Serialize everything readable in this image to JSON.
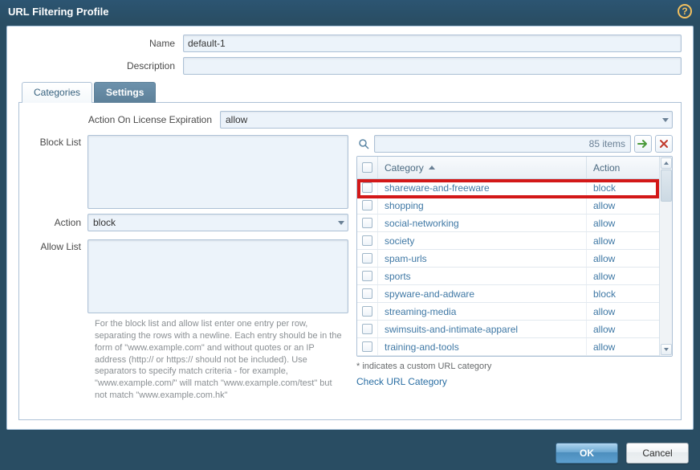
{
  "window": {
    "title": "URL Filtering Profile"
  },
  "form": {
    "name_label": "Name",
    "name_value": "default-1",
    "description_label": "Description",
    "description_value": ""
  },
  "tabs": {
    "categories": "Categories",
    "settings": "Settings",
    "active": "settings"
  },
  "settings": {
    "license_label": "Action On License Expiration",
    "license_value": "allow",
    "block_list_label": "Block List",
    "block_list_value": "",
    "action_label": "Action",
    "action_value": "block",
    "allow_list_label": "Allow List",
    "allow_list_value": "",
    "help_text": "For the block list and allow list enter one entry per row, separating the rows with a newline. Each entry should be in the form of \"www.example.com\" and without quotes or an IP address (http:// or https:// should not be included). Use separators to specify match criteria - for example, \"www.example.com/\" will match \"www.example.com/test\" but not match \"www.example.com.hk\""
  },
  "category_table": {
    "search_placeholder": "85 items",
    "header_category": "Category",
    "header_action": "Action",
    "rows": [
      {
        "name": "shareware-and-freeware",
        "action": "block"
      },
      {
        "name": "shopping",
        "action": "allow"
      },
      {
        "name": "social-networking",
        "action": "allow"
      },
      {
        "name": "society",
        "action": "allow"
      },
      {
        "name": "spam-urls",
        "action": "allow"
      },
      {
        "name": "sports",
        "action": "allow"
      },
      {
        "name": "spyware-and-adware",
        "action": "block"
      },
      {
        "name": "streaming-media",
        "action": "allow"
      },
      {
        "name": "swimsuits-and-intimate-apparel",
        "action": "allow"
      },
      {
        "name": "training-and-tools",
        "action": "allow"
      }
    ],
    "footnote": "* indicates a custom URL category",
    "check_link": "Check URL Category"
  },
  "footer": {
    "ok": "OK",
    "cancel": "Cancel"
  }
}
